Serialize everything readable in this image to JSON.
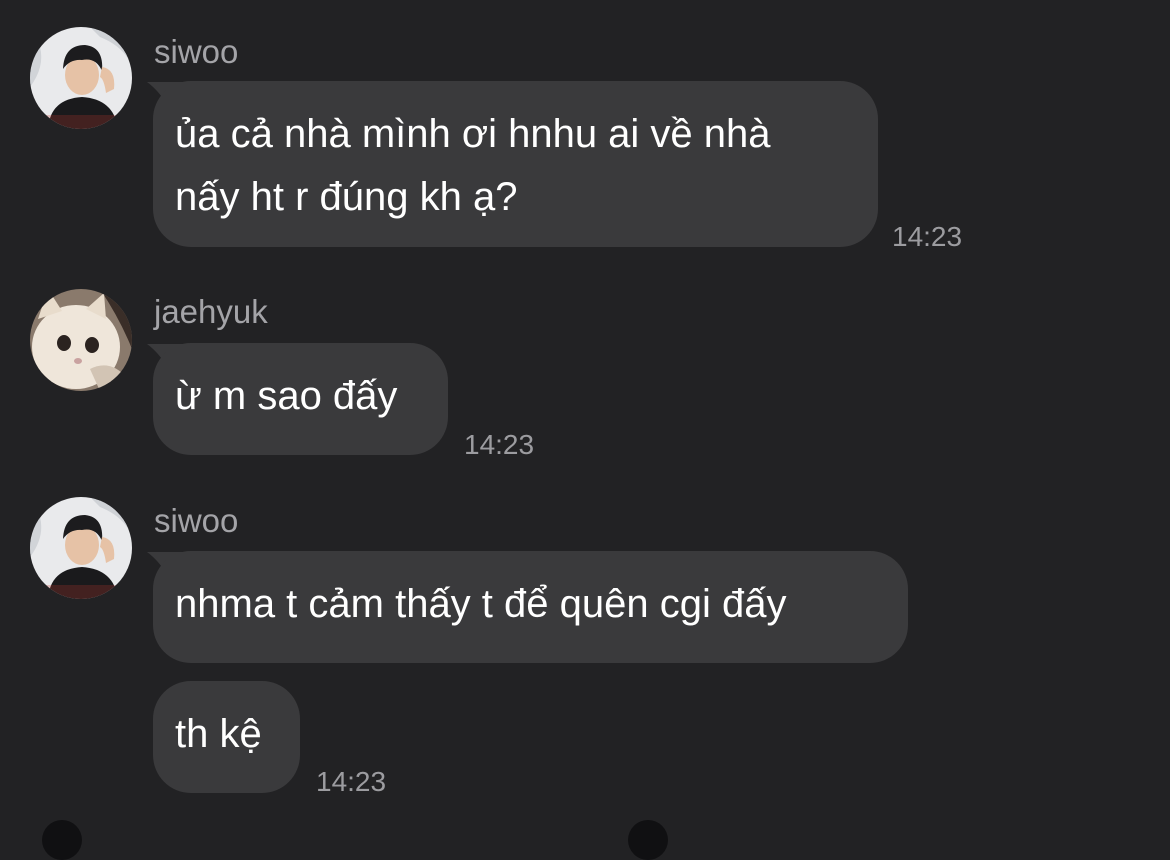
{
  "messages": [
    {
      "sender": "siwoo",
      "avatar_icon": "user-photo-icon",
      "bubbles": [
        {
          "lines": [
            "ủa cả nhà mình ơi hnhu ai về nhà",
            "nấy ht r đúng kh ạ?"
          ]
        }
      ],
      "time": "14:23"
    },
    {
      "sender": "jaehyuk",
      "avatar_icon": "cat-photo-icon",
      "bubbles": [
        {
          "lines": [
            "ừ m sao đấy"
          ]
        }
      ],
      "time": "14:23"
    },
    {
      "sender": "siwoo",
      "avatar_icon": "user-photo-icon",
      "bubbles": [
        {
          "lines": [
            "nhma t cảm thấy t để quên cgi đấy"
          ]
        },
        {
          "lines": [
            "th kệ"
          ]
        }
      ],
      "time": "14:23"
    }
  ],
  "colors": {
    "background": "#222224",
    "bubble": "#3a3a3c",
    "text": "#ffffff",
    "meta": "#a4a4a8"
  }
}
